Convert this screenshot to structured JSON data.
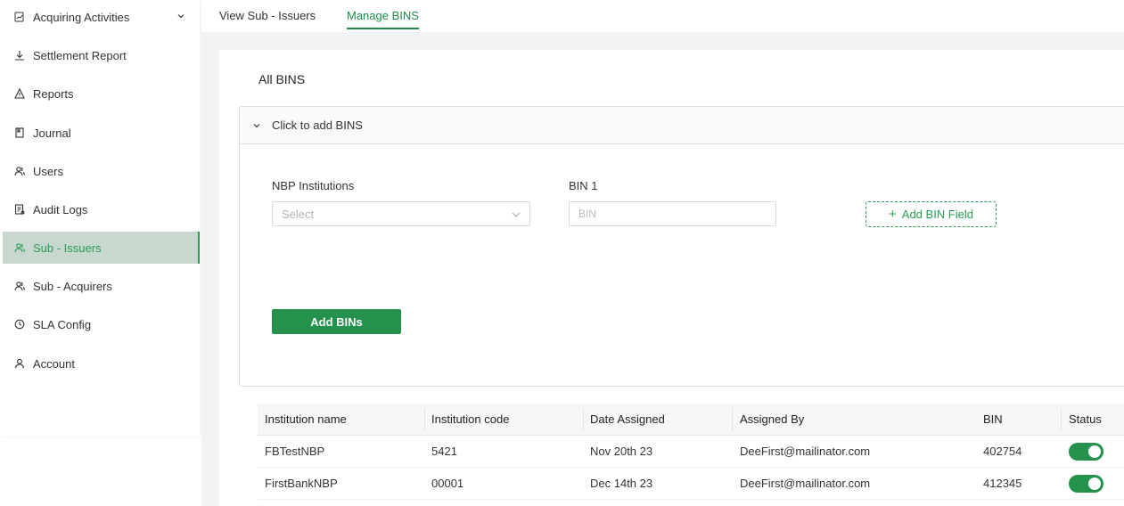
{
  "sidebar": {
    "items": [
      {
        "label": "Acquiring Activities",
        "icon": "chart-doc-icon",
        "has_chevron": true
      },
      {
        "label": "Settlement Report",
        "icon": "download-icon"
      },
      {
        "label": "Reports",
        "icon": "warning-icon"
      },
      {
        "label": "Journal",
        "icon": "book-icon"
      },
      {
        "label": "Users",
        "icon": "users-icon"
      },
      {
        "label": "Audit Logs",
        "icon": "audit-doc-icon"
      },
      {
        "label": "Sub - Issuers",
        "icon": "users-icon",
        "active": true
      },
      {
        "label": "Sub - Acquirers",
        "icon": "users-icon"
      },
      {
        "label": "SLA Config",
        "icon": "clock-icon"
      },
      {
        "label": "Account",
        "icon": "user-icon"
      }
    ]
  },
  "tabs": [
    {
      "label": "View Sub - Issuers"
    },
    {
      "label": "Manage BINS",
      "active": true
    }
  ],
  "card": {
    "title": "All BINS",
    "collapse_label": "Click to add BINS",
    "form": {
      "institution_label": "NBP Institutions",
      "institution_placeholder": "Select",
      "bin_label": "BIN 1",
      "bin_placeholder": "BIN",
      "add_field_label": "Add BIN Field",
      "submit_label": "Add BINs"
    }
  },
  "table": {
    "columns": [
      "Institution name",
      "Institution code",
      "Date Assigned",
      "Assigned By",
      "BIN",
      "Status"
    ],
    "rows": [
      {
        "institution_name": "FBTestNBP",
        "institution_code": "5421",
        "date_assigned": "Nov 20th 23",
        "assigned_by": "DeeFirst@mailinator.com",
        "bin": "402754",
        "status": true
      },
      {
        "institution_name": "FirstBankNBP",
        "institution_code": "00001",
        "date_assigned": "Dec 14th 23",
        "assigned_by": "DeeFirst@mailinator.com",
        "bin": "412345",
        "status": true
      }
    ]
  },
  "colors": {
    "accent": "#24914d",
    "active_nav_bg": "#c9d8cf",
    "page_bg": "#f2f3f5"
  }
}
